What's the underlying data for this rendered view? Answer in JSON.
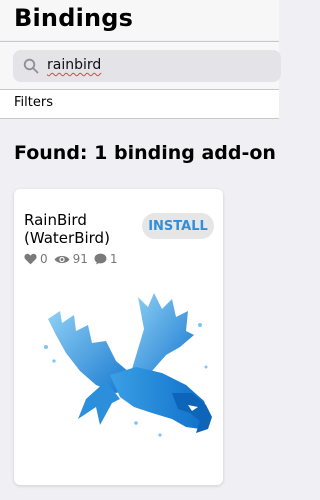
{
  "header": {
    "title": "Bindings"
  },
  "search": {
    "value": "rainbird"
  },
  "filters": {
    "label": "Filters"
  },
  "results": {
    "found_text": "Found: 1 binding add-on"
  },
  "card": {
    "title_line1": "RainBird",
    "title_line2": "(WaterBird)",
    "install_label": "INSTALL",
    "likes": "0",
    "views": "91",
    "comments": "1",
    "logo_icon": "bird-logo-icon"
  },
  "colors": {
    "accent": "#2f8fd8",
    "bird_blue": "#1f86d9",
    "bird_light": "#7cc7f2"
  }
}
